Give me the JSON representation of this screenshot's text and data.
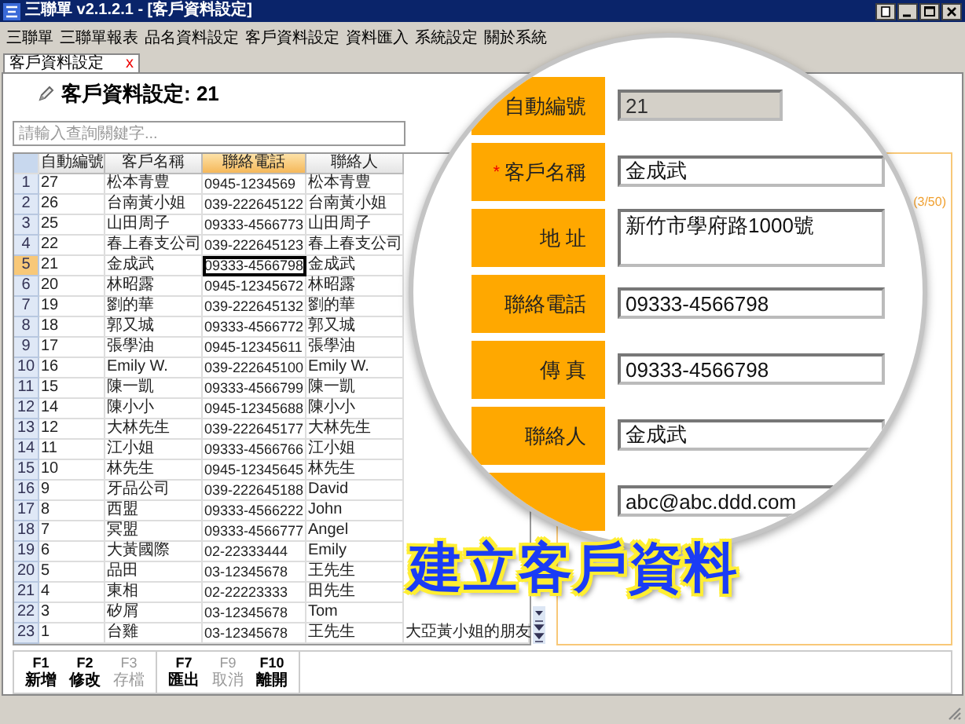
{
  "window": {
    "title": "三聯單 v2.1.2.1 - [客戶資料設定]"
  },
  "menu": [
    {
      "label": "三聯單"
    },
    {
      "label": "三聯單報表"
    },
    {
      "label": "品名資料設定"
    },
    {
      "label": "客戶資料設定"
    },
    {
      "label": "資料匯入"
    },
    {
      "label": "系統設定"
    },
    {
      "label": "關於系統"
    }
  ],
  "tabs": [
    {
      "label": "客戶資料設定",
      "selected": true,
      "close": "x"
    }
  ],
  "heading": "客戶資料設定: 21",
  "search": {
    "placeholder": "請輸入查詢關鍵字..."
  },
  "table": {
    "columns": [
      {
        "label": "自動編號",
        "selected": false
      },
      {
        "label": "客戶名稱",
        "selected": false
      },
      {
        "label": "聯絡電話",
        "selected": true
      },
      {
        "label": "聯絡人",
        "selected": false
      }
    ],
    "rows": [
      {
        "number": "1",
        "selected": false,
        "cells": [
          "27",
          "松本青豊",
          "0945-1234569",
          "松本青豊"
        ]
      },
      {
        "number": "2",
        "selected": false,
        "cells": [
          "26",
          "台南黃小姐",
          "039-222645122",
          "台南黃小姐"
        ]
      },
      {
        "number": "3",
        "selected": false,
        "cells": [
          "25",
          "山田周子",
          "09333-4566773",
          "山田周子"
        ]
      },
      {
        "number": "4",
        "selected": false,
        "cells": [
          "22",
          "春上春支公司",
          "039-222645123",
          "春上春支公司"
        ]
      },
      {
        "number": "5",
        "selected": true,
        "cells": [
          "21",
          "金成武",
          "09333-4566798",
          "金成武"
        ]
      },
      {
        "number": "6",
        "selected": false,
        "cells": [
          "20",
          "林昭露",
          "0945-12345672",
          "林昭露"
        ]
      },
      {
        "number": "7",
        "selected": false,
        "cells": [
          "19",
          "劉的華",
          "039-222645132",
          "劉的華"
        ]
      },
      {
        "number": "8",
        "selected": false,
        "cells": [
          "18",
          "郭又城",
          "09333-4566772",
          "郭又城"
        ]
      },
      {
        "number": "9",
        "selected": false,
        "cells": [
          "17",
          "張學油",
          "0945-12345611",
          "張學油"
        ]
      },
      {
        "number": "10",
        "selected": false,
        "cells": [
          "16",
          "Emily W.",
          "039-222645100",
          "Emily W."
        ]
      },
      {
        "number": "11",
        "selected": false,
        "cells": [
          "15",
          "陳一凱",
          "09333-4566799",
          "陳一凱"
        ]
      },
      {
        "number": "12",
        "selected": false,
        "cells": [
          "14",
          "陳小小",
          "0945-12345688",
          "陳小小"
        ]
      },
      {
        "number": "13",
        "selected": false,
        "cells": [
          "12",
          "大林先生",
          "039-222645177",
          "大林先生"
        ]
      },
      {
        "number": "14",
        "selected": false,
        "cells": [
          "11",
          "江小姐",
          "09333-4566766",
          "江小姐"
        ]
      },
      {
        "number": "15",
        "selected": false,
        "cells": [
          "10",
          "林先生",
          "0945-12345645",
          "林先生"
        ]
      },
      {
        "number": "16",
        "selected": false,
        "cells": [
          "9",
          "牙品公司",
          "039-222645188",
          "David"
        ]
      },
      {
        "number": "17",
        "selected": false,
        "cells": [
          "8",
          "西盟",
          "09333-4566222",
          "John"
        ]
      },
      {
        "number": "18",
        "selected": false,
        "cells": [
          "7",
          "冥盟",
          "09333-4566777",
          "Angel"
        ]
      },
      {
        "number": "19",
        "selected": false,
        "cells": [
          "6",
          "大黃國際",
          "02-22333444",
          "Emily"
        ]
      },
      {
        "number": "20",
        "selected": false,
        "cells": [
          "5",
          "品田",
          "03-12345678",
          "王先生"
        ]
      },
      {
        "number": "21",
        "selected": false,
        "cells": [
          "4",
          "東相",
          "02-22223333",
          "田先生"
        ]
      },
      {
        "number": "22",
        "selected": false,
        "cells": [
          "3",
          "矽屑",
          "03-12345678",
          "Tom"
        ]
      },
      {
        "number": "23",
        "selected": false,
        "cells": [
          "1",
          "台雞",
          "03-12345678",
          "王先生",
          "大亞黃小姐的朋友"
        ]
      }
    ]
  },
  "form_panel": {
    "counter": "(3/50)"
  },
  "form": {
    "fields": [
      {
        "label": "自動編號",
        "kind": "input",
        "value": "21",
        "disabled": true
      },
      {
        "label": "客戶名稱",
        "marker": "*",
        "kind": "input",
        "value": "金成武",
        "disabled": false
      },
      {
        "label": "地 址",
        "kind": "textarea",
        "value": "新竹市學府路1000號",
        "disabled": false
      },
      {
        "label": "聯絡電話",
        "kind": "input",
        "value": "09333-4566798",
        "disabled": false
      },
      {
        "label": "傳 真",
        "kind": "input",
        "value": "09333-4566798",
        "disabled": false
      },
      {
        "label": "聯絡人",
        "kind": "input",
        "value": "金成武",
        "disabled": false
      },
      {
        "kind": "input",
        "value": "abc@abc.ddd.com",
        "disabled": false
      }
    ]
  },
  "caption": "建立客戶資料",
  "toolbar": {
    "groups": [
      [
        {
          "key": "F1",
          "label": "新增",
          "disabled": false
        },
        {
          "key": "F2",
          "label": "修改",
          "disabled": false
        },
        {
          "key": "F3",
          "label": "存檔",
          "disabled": true
        }
      ],
      [
        {
          "key": "F7",
          "label": "匯出",
          "disabled": false
        },
        {
          "key": "F9",
          "label": "取消",
          "disabled": true
        },
        {
          "key": "F10",
          "label": "離開",
          "disabled": false
        }
      ]
    ]
  }
}
